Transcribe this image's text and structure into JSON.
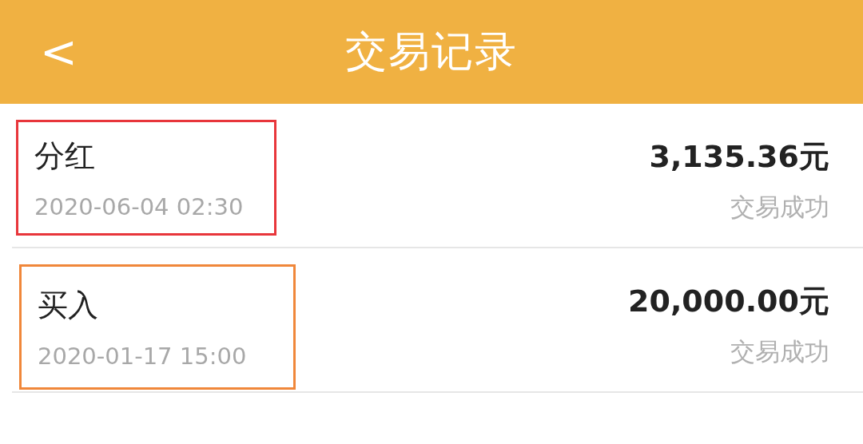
{
  "header": {
    "back": "<",
    "title": "交易记录"
  },
  "records": [
    {
      "type": "分红",
      "time": "2020-06-04 02:30",
      "amount": "3,135.36元",
      "status": "交易成功",
      "color": "#e8363b"
    },
    {
      "type": "买入",
      "time": "2020-01-17 15:00",
      "amount": "20,000.00元",
      "status": "交易成功",
      "color": "#f0873a"
    }
  ]
}
